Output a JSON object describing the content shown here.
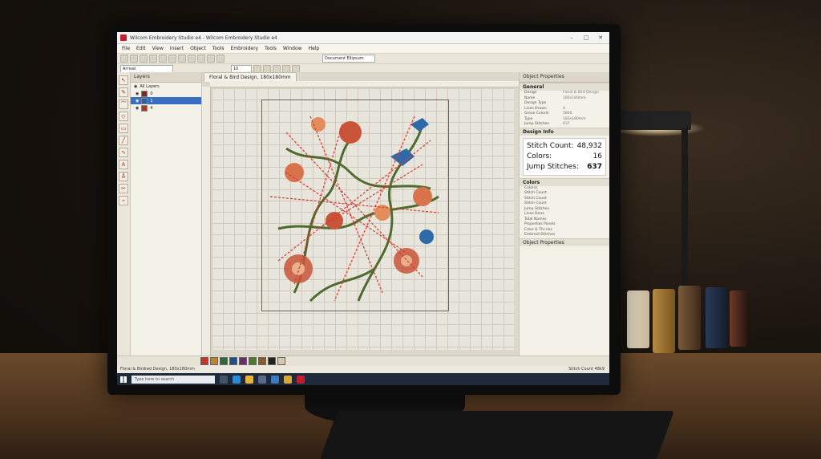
{
  "window": {
    "title": "Wilcom Embroidery Studio e4 - Wilcom Embroidery Studio e4"
  },
  "menu": [
    "File",
    "Edit",
    "View",
    "Insert",
    "Object",
    "Tools",
    "Embroidery",
    "Tools",
    "Window",
    "Help"
  ],
  "toolbar": {
    "font_name": "Arrival",
    "font_size": "10",
    "design_dropdown": "Document Ellipsum"
  },
  "layers_panel": {
    "title": "Layers",
    "root": "All Layers",
    "rows": [
      {
        "label": "0",
        "color": "#7b2b22"
      },
      {
        "label": "1",
        "color": "#2c5faa"
      },
      {
        "label": "4",
        "color": "#a33a2c"
      }
    ]
  },
  "document": {
    "tab": "Floral & Bird Design, 180x180mm"
  },
  "properties": {
    "title": "Object Properties",
    "general_header": "General",
    "general_rows": [
      {
        "k": "Design",
        "v": "Floral & Bird Design"
      },
      {
        "k": "Name",
        "v": "180x180mm"
      },
      {
        "k": "Design Type",
        "v": ""
      },
      {
        "k": "Lines Drawn",
        "v": "4"
      },
      {
        "k": "Grove Colorls",
        "v": "5800"
      },
      {
        "k": "Type",
        "v": "180x180mm"
      },
      {
        "k": "Jump Stitches",
        "v": "637"
      }
    ],
    "design_info_header": "Design Info",
    "stitch_count_label": "Stitch Count:",
    "stitch_count": "48,932",
    "colors_label": "Colors:",
    "colors": "16",
    "jump_label": "Jump Stitches:",
    "jump": "637",
    "colors_header": "Colors",
    "color_rows": [
      "Colorss",
      "Stitch Count",
      "Stitch Count",
      "Stitch Count",
      "Jump Stitches",
      "Lines Done",
      "Total Names",
      "Properties Panels",
      "Color & Thr.ries",
      "Embroid Stitches"
    ],
    "footer": "Object Properties"
  },
  "palette": [
    "#c0342a",
    "#b8862e",
    "#2d6b3a",
    "#1f4f8a",
    "#6a2d6a",
    "#4a7a2a",
    "#8a5a2a",
    "#222222",
    "#d8c8a8"
  ],
  "status": {
    "left": "Floral & Birdred Design, 180x180mm",
    "right": "Stitch Count 48k9"
  },
  "taskbar": {
    "search_placeholder": "Type here to search"
  },
  "art": {
    "thread_red": "#d8382e",
    "leaf": "#4f6b2e",
    "flower": "#c8553a",
    "bird": "#2f6aa8"
  }
}
